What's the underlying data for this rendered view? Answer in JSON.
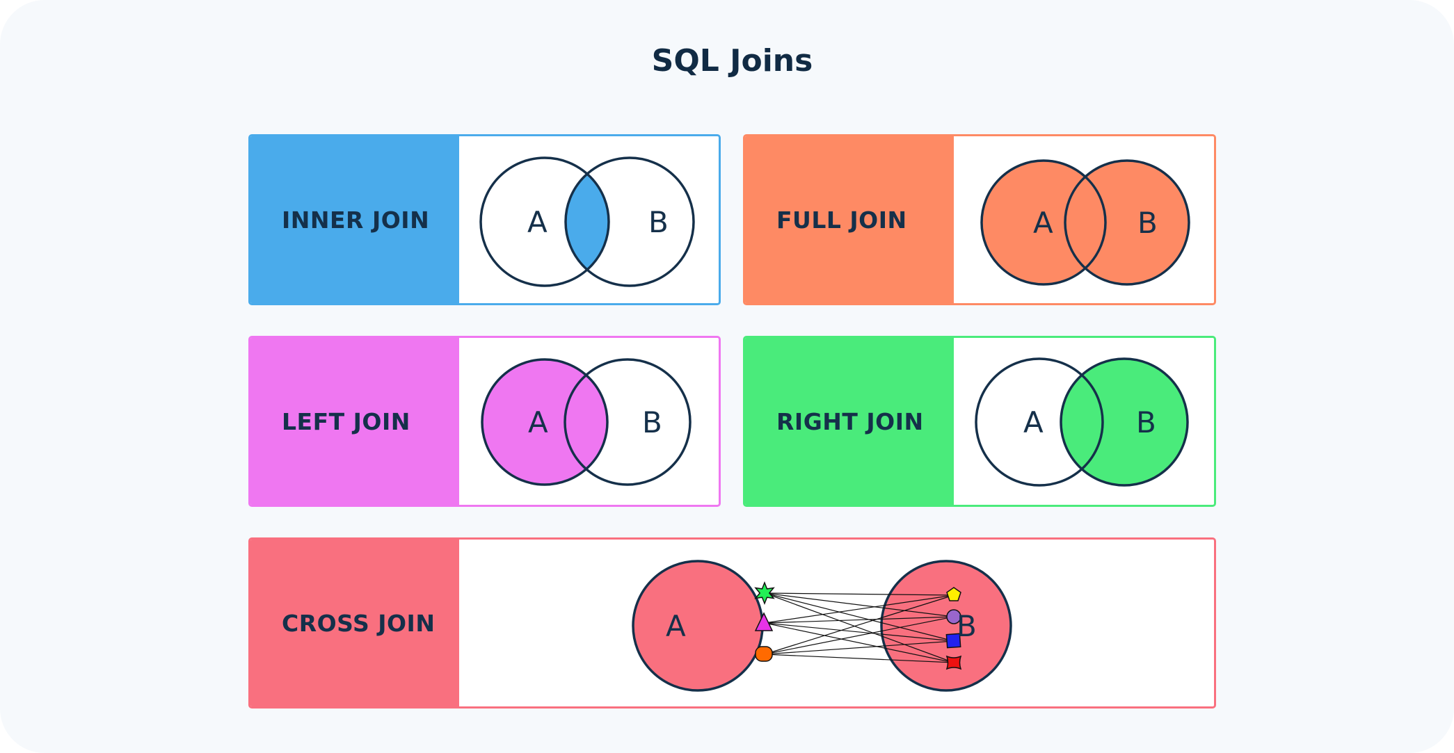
{
  "title": "SQL Joins",
  "colors": {
    "background": "#f6f9fc",
    "ink": "#15304a",
    "inner": "#4aabeb",
    "full": "#fe8a64",
    "left": "#ef77f1",
    "right": "#4aeb7b",
    "cross": "#f9707f"
  },
  "joins": {
    "inner": {
      "label": "INNER JOIN",
      "set_a": "A",
      "set_b": "B",
      "highlight": "intersection"
    },
    "full": {
      "label": "FULL JOIN",
      "set_a": "A",
      "set_b": "B",
      "highlight": "union"
    },
    "left": {
      "label": "LEFT JOIN",
      "set_a": "A",
      "set_b": "B",
      "highlight": "A"
    },
    "right": {
      "label": "RIGHT JOIN",
      "set_a": "A",
      "set_b": "B",
      "highlight": "B"
    },
    "cross": {
      "label": "CROSS JOIN",
      "set_a": "A",
      "set_b": "B",
      "highlight": "cartesian-product",
      "set_a_items": [
        {
          "shape": "star",
          "color": "#22ee55"
        },
        {
          "shape": "triangle",
          "color": "#e633e6"
        },
        {
          "shape": "rounded-rect",
          "color": "#ff6a00"
        }
      ],
      "set_b_items": [
        {
          "shape": "pentagon",
          "color": "#ffee00"
        },
        {
          "shape": "circle",
          "color": "#9966cc"
        },
        {
          "shape": "square",
          "color": "#2222ee"
        },
        {
          "shape": "bowtie-square",
          "color": "#ee1111"
        }
      ]
    }
  }
}
